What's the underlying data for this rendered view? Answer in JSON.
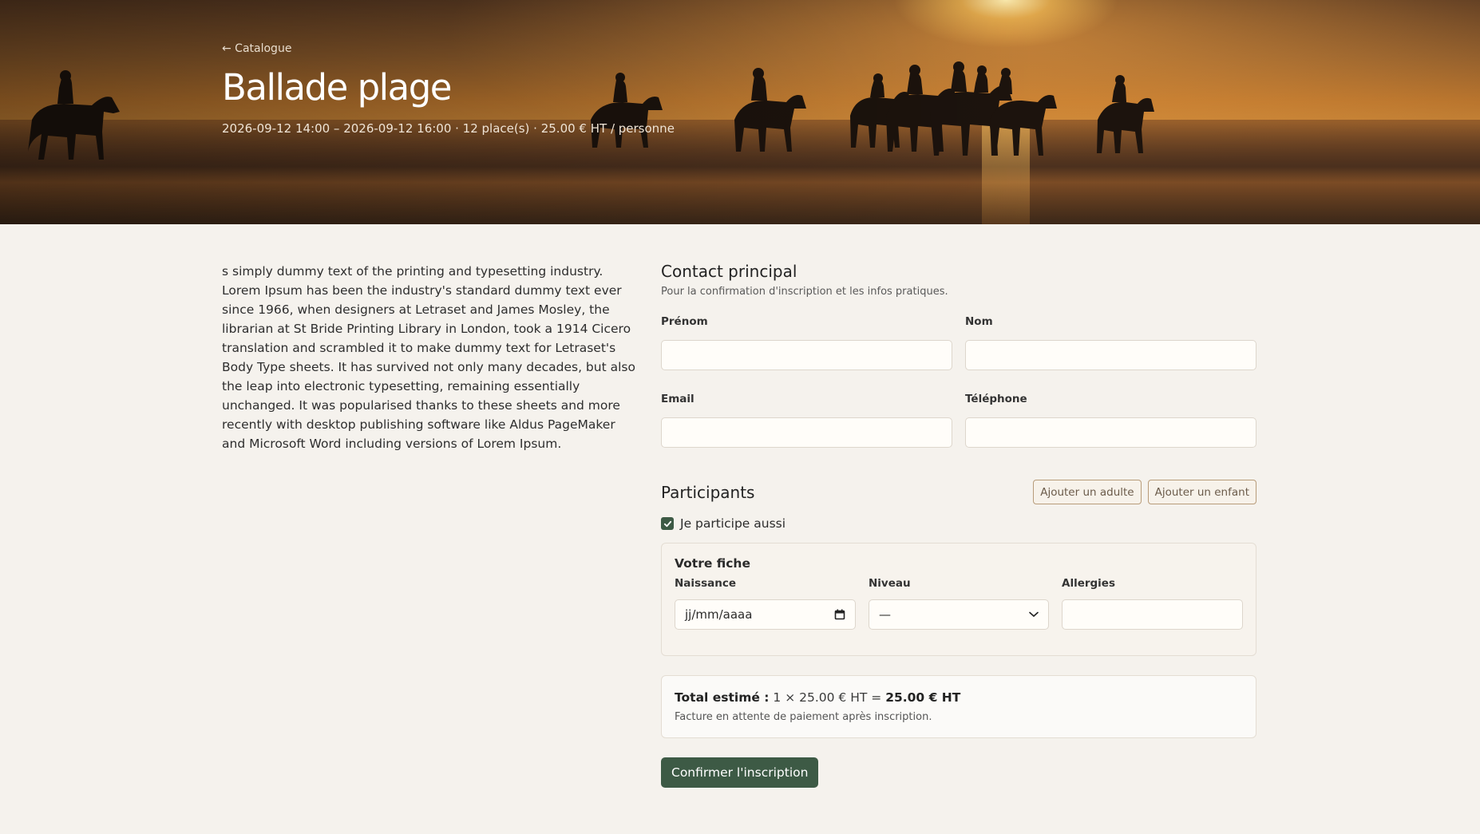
{
  "hero": {
    "back_label": "← Catalogue",
    "title": "Ballade plage",
    "meta": "2026-09-12 14:00 – 2026-09-12 16:00 · 12 place(s) · 25.00 € HT / personne"
  },
  "description": "s simply dummy text of the printing and typesetting industry. Lorem Ipsum has been the industry's standard dummy text ever since 1966, when designers at Letraset and James Mosley, the librarian at St Bride Printing Library in London, took a 1914 Cicero translation and scrambled it to make dummy text for Letraset's Body Type sheets. It has survived not only many decades, but also the leap into electronic typesetting, remaining essentially unchanged. It was popularised thanks to these sheets and more recently with desktop publishing software like Aldus PageMaker and Microsoft Word including versions of Lorem Ipsum.",
  "contact": {
    "title": "Contact principal",
    "subtitle": "Pour la confirmation d'inscription et les infos pratiques.",
    "firstname_label": "Prénom",
    "firstname_value": "",
    "lastname_label": "Nom",
    "lastname_value": "",
    "email_label": "Email",
    "email_value": "",
    "phone_label": "Téléphone",
    "phone_value": ""
  },
  "participants": {
    "title": "Participants",
    "add_adult_label": "Ajouter un adulte",
    "add_child_label": "Ajouter un enfant",
    "self_participates_label": "Je participe aussi",
    "self_participates_checked": true,
    "card": {
      "title": "Votre fiche",
      "birth_label": "Naissance",
      "birth_placeholder": "jj/mm/aaaa",
      "level_label": "Niveau",
      "level_value": "—",
      "allergies_label": "Allergies",
      "allergies_value": ""
    }
  },
  "total": {
    "label": "Total estimé :",
    "calc": "1 × 25.00 € HT =",
    "amount": "25.00 € HT",
    "note": "Facture en attente de paiement après inscription."
  },
  "confirm_label": "Confirmer l'inscription",
  "colors": {
    "accent": "#3d5a45",
    "background": "#f5f2ed",
    "outline_button_border": "#b89c7a"
  }
}
